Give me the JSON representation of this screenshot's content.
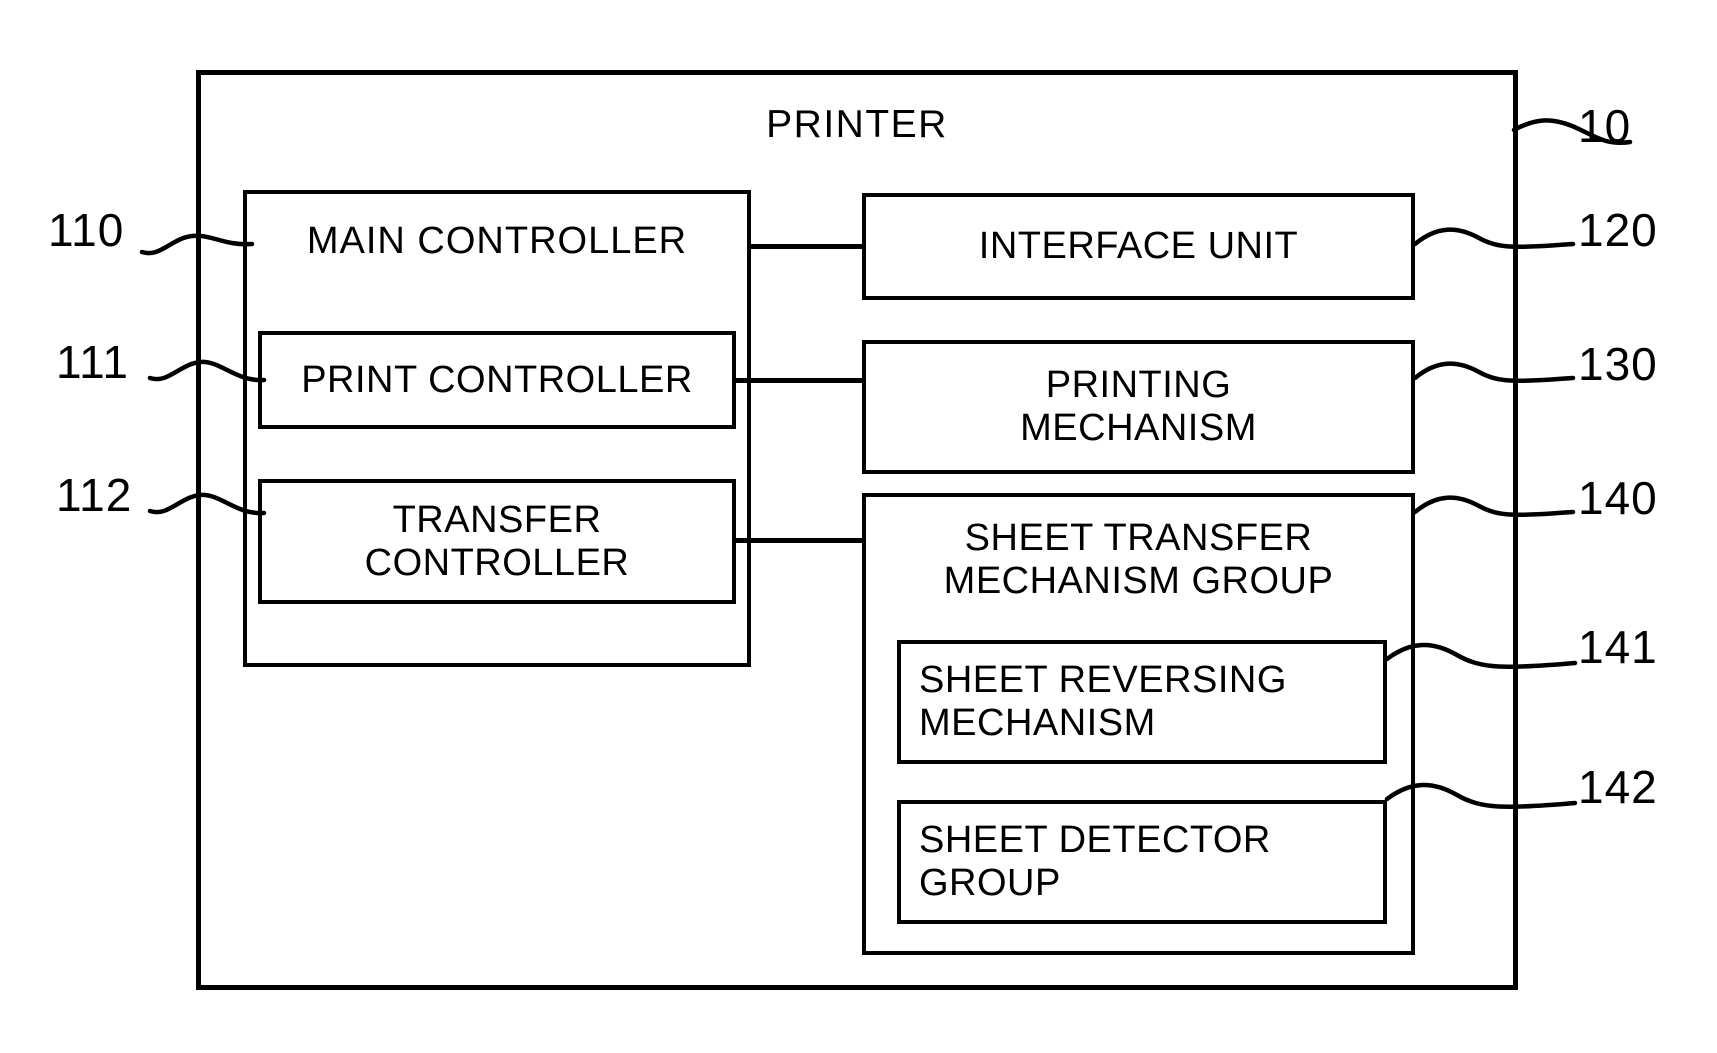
{
  "diagram": {
    "title": "PRINTER",
    "outer": {
      "label": "PRINTER",
      "ref": "10"
    },
    "blocks": {
      "main_controller": {
        "label": "MAIN  CONTROLLER",
        "ref": "110"
      },
      "print_controller": {
        "label": "PRINT  CONTROLLER",
        "ref": "111"
      },
      "transfer_controller": {
        "line1": "TRANSFER",
        "line2": "CONTROLLER",
        "ref": "112"
      },
      "interface_unit": {
        "label": "INTERFACE  UNIT",
        "ref": "120"
      },
      "printing_mechanism": {
        "line1": "PRINTING",
        "line2": "MECHANISM",
        "ref": "130"
      },
      "sheet_transfer_group": {
        "line1": "SHEET  TRANSFER",
        "line2": "MECHANISM  GROUP",
        "ref": "140"
      },
      "sheet_reversing_mechanism": {
        "line1": "SHEET  REVERSING",
        "line2": "MECHANISM",
        "ref": "141"
      },
      "sheet_detector_group": {
        "line1": "SHEET  DETECTOR",
        "line2": "GROUP",
        "ref": "142"
      }
    },
    "connections": [
      {
        "from": "main_controller",
        "to": "interface_unit"
      },
      {
        "from": "print_controller",
        "to": "printing_mechanism"
      },
      {
        "from": "transfer_controller",
        "to": "sheet_transfer_group"
      }
    ],
    "colors": {
      "line": "#000000",
      "background": "#ffffff"
    }
  }
}
